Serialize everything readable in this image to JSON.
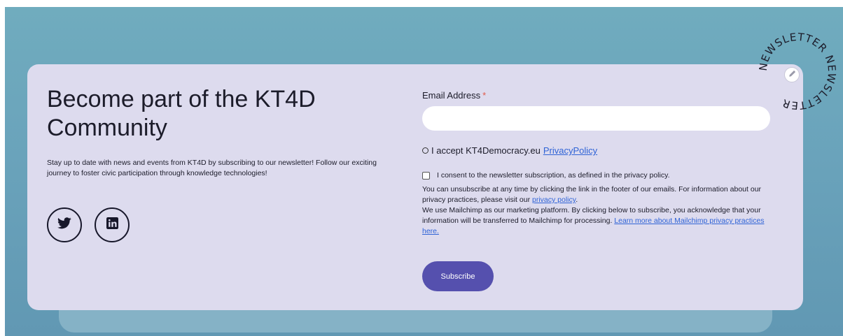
{
  "hero": {
    "title": "Become part of the KT4D Community",
    "description": "Stay up to date with news and events from KT4D by subscribing to our newsletter! Follow our exciting journey to foster civic participation through knowledge technologies!"
  },
  "social": [
    {
      "name": "twitter",
      "icon": "twitter-icon"
    },
    {
      "name": "linkedin",
      "icon": "linkedin-icon"
    }
  ],
  "form": {
    "email_label": "Email Address",
    "required_mark": "*",
    "email_value": "",
    "privacy_text": "I accept KT4Democracy.eu",
    "privacy_link": "PrivacyPolicy",
    "consent_text": "I consent to the newsletter subscription, as defined in the privacy policy.",
    "info_1": "You can unsubscribe at any time by clicking the link in the footer of our emails. For information about our privacy practices, please visit our",
    "info_link_1": "privacy policy",
    "info_2": "We use Mailchimp as our marketing platform. By clicking below to subscribe, you acknowledge that your information will be transferred to Mailchimp for processing.",
    "info_link_2": "Learn more about Mailchimp privacy practices here.",
    "subscribe_label": "Subscribe"
  },
  "badge": {
    "text": "NEWSLETTER NEWSLETTER "
  },
  "colors": {
    "card": "#dddbee",
    "accent": "#5550ae",
    "link": "#2f63d6",
    "required": "#e05a4a"
  }
}
